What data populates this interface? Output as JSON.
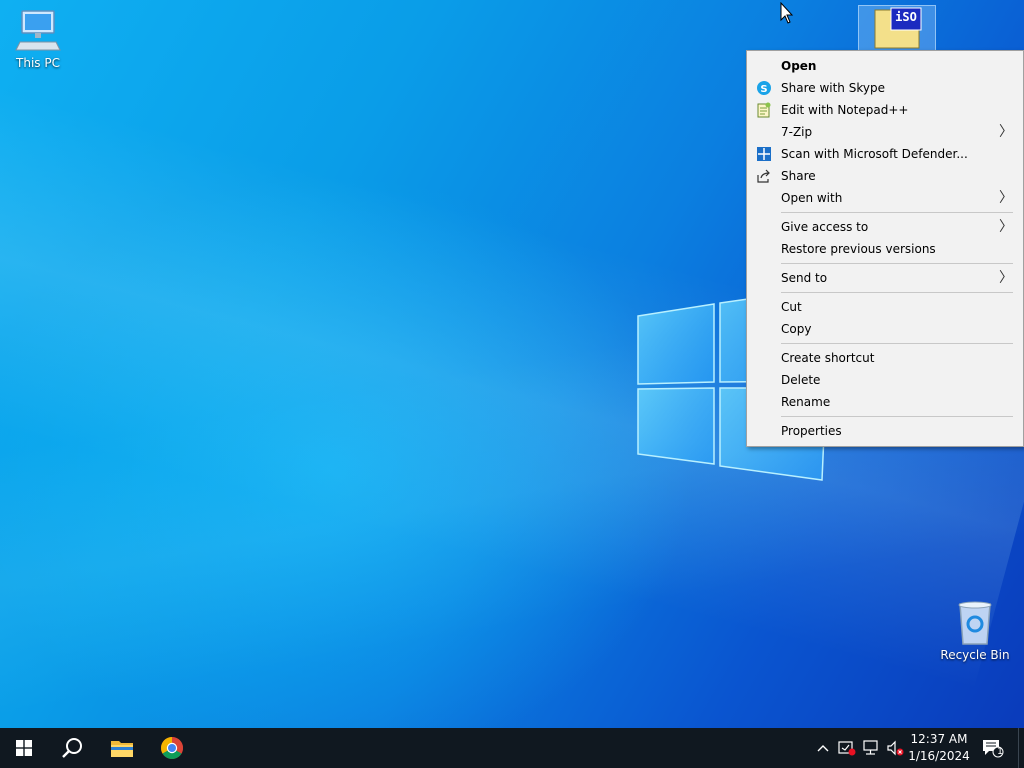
{
  "desktop": {
    "icons": {
      "this_pc": "This PC",
      "recycle_bin": "Recycle Bin",
      "iso_file_badge": "iSO"
    }
  },
  "context_menu": {
    "open": "Open",
    "share_skype": "Share with Skype",
    "edit_notepad": "Edit with Notepad++",
    "seven_zip": "7-Zip",
    "scan_defender": "Scan with Microsoft Defender...",
    "share": "Share",
    "open_with": "Open with",
    "give_access": "Give access to",
    "restore_versions": "Restore previous versions",
    "send_to": "Send to",
    "cut": "Cut",
    "copy": "Copy",
    "create_shortcut": "Create shortcut",
    "delete": "Delete",
    "rename": "Rename",
    "properties": "Properties",
    "submenu_arrow": "〉"
  },
  "taskbar": {
    "time": "12:37 AM",
    "date": "1/16/2024",
    "notification_count": "1"
  },
  "colors": {
    "accent": "#0a78d7",
    "taskbar_bg": "#101820",
    "menu_bg": "#f2f2f2"
  }
}
